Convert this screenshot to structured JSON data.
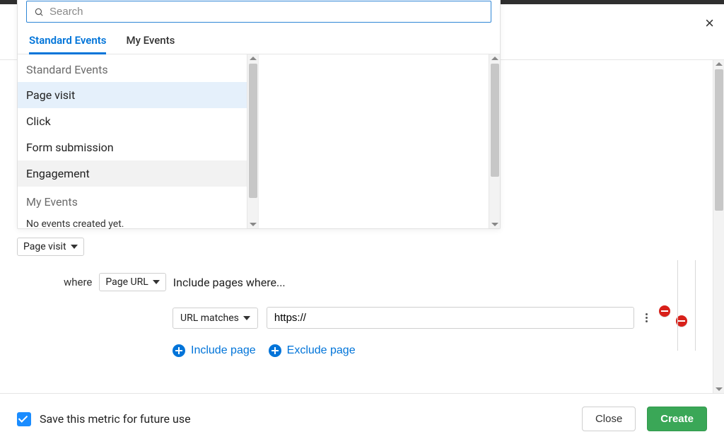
{
  "search": {
    "placeholder": "Search",
    "value": ""
  },
  "tabs": [
    {
      "label": "Standard Events",
      "active": true
    },
    {
      "label": "My Events",
      "active": false
    }
  ],
  "event_list": {
    "groups": [
      {
        "label": "Standard Events",
        "items": [
          {
            "label": "Page visit",
            "state": "selected"
          },
          {
            "label": "Click",
            "state": ""
          },
          {
            "label": "Form submission",
            "state": ""
          },
          {
            "label": "Engagement",
            "state": "hover"
          }
        ]
      },
      {
        "label": "My Events",
        "empty": "No events created yet."
      }
    ]
  },
  "rule": {
    "event_selected": "Page visit",
    "where_label": "where",
    "field_selected": "Page URL",
    "include_heading": "Include pages where...",
    "match_type": "URL matches",
    "url_value": "https://"
  },
  "links": {
    "include": "Include page",
    "exclude": "Exclude page"
  },
  "footer": {
    "save_label": "Save this metric for future use",
    "save_checked": true,
    "close": "Close",
    "create": "Create"
  },
  "close_icon": "×",
  "colors": {
    "accent": "#0074d9",
    "primary_btn": "#3aa757",
    "checkbox": "#1a8cff",
    "danger": "#d8201a"
  }
}
